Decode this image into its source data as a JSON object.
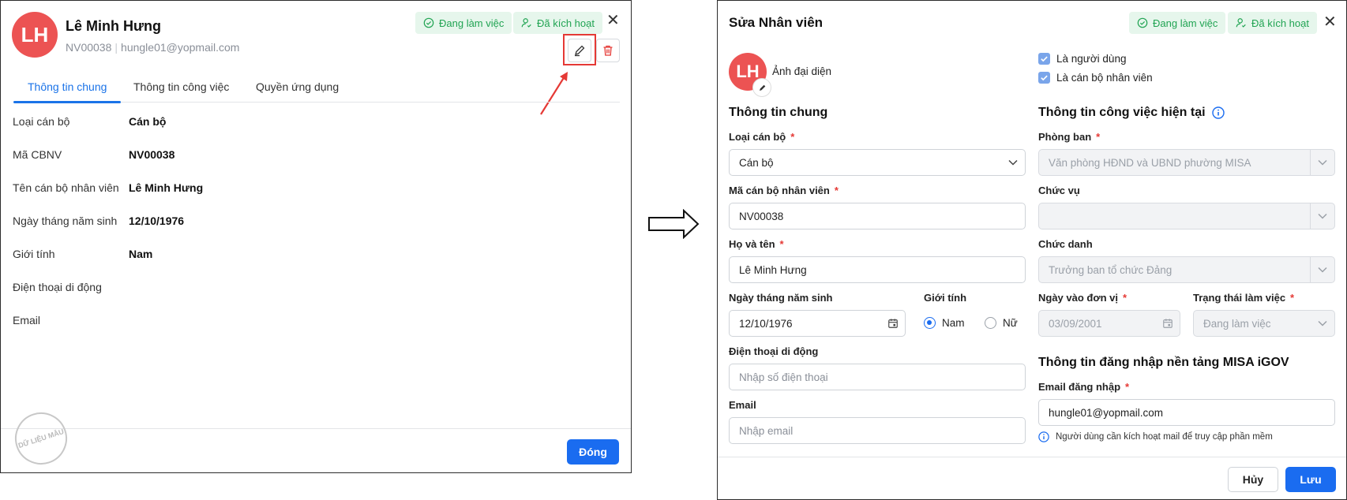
{
  "view": {
    "avatar_initials": "LH",
    "name": "Lê Minh Hưng",
    "code": "NV00038",
    "email": "hungle01@yopmail.com",
    "badges": {
      "working": "Đang làm việc",
      "activated": "Đã kích hoạt"
    },
    "tabs": [
      "Thông tin chung",
      "Thông tin công việc",
      "Quyền ứng dụng"
    ],
    "rows": [
      {
        "label": "Loại cán bộ",
        "value": "Cán bộ"
      },
      {
        "label": "Mã CBNV",
        "value": "NV00038"
      },
      {
        "label": "Tên cán bộ nhân viên",
        "value": "Lê Minh Hưng"
      },
      {
        "label": "Ngày tháng năm sinh",
        "value": "12/10/1976"
      },
      {
        "label": "Giới tính",
        "value": "Nam"
      },
      {
        "label": "Điện thoại di động",
        "value": ""
      },
      {
        "label": "Email",
        "value": ""
      }
    ],
    "close_label": "Đóng",
    "stamp_text": "DỮ LIỆU MẪU"
  },
  "edit": {
    "title": "Sửa Nhân viên",
    "badges": {
      "working": "Đang làm việc",
      "activated": "Đã kích hoạt"
    },
    "avatar_initials": "LH",
    "avatar_label": "Ảnh đại diện",
    "checks": {
      "is_user": "Là người dùng",
      "is_staff": "Là cán bộ nhân viên"
    },
    "general": {
      "title": "Thông tin chung",
      "staff_type_label": "Loại cán bộ",
      "staff_type_value": "Cán bộ",
      "code_label": "Mã cán bộ nhân viên",
      "code_value": "NV00038",
      "fullname_label": "Họ và tên",
      "fullname_value": "Lê Minh Hưng",
      "dob_label": "Ngày tháng năm sinh",
      "dob_value": "12/10/1976",
      "gender_label": "Giới tính",
      "gender_male": "Nam",
      "gender_female": "Nữ",
      "phone_label": "Điện thoại di động",
      "phone_placeholder": "Nhập số điện thoại",
      "email_label": "Email",
      "email_placeholder": "Nhập email"
    },
    "job": {
      "title": "Thông tin công việc hiện tại",
      "dept_label": "Phòng ban",
      "dept_value": "Văn phòng HĐND và UBND phường MISA",
      "position_label": "Chức vụ",
      "position_value": "",
      "jobtitle_label": "Chức danh",
      "jobtitle_value": "Trưởng ban tổ chức Đảng",
      "join_label": "Ngày vào đơn vị",
      "join_value": "03/09/2001",
      "status_label": "Trạng thái làm việc",
      "status_value": "Đang làm việc"
    },
    "login": {
      "title": "Thông tin đăng nhập nền tảng MISA iGOV",
      "email_label": "Email đăng nhập",
      "email_value": "hungle01@yopmail.com",
      "note": "Người dùng cần kích hoạt mail để truy cập phần mềm"
    },
    "cancel_label": "Hủy",
    "save_label": "Lưu"
  },
  "colors": {
    "primary": "#1a6cf0",
    "avatar": "#ec5353",
    "badge_bg": "#e6f6ec",
    "badge_text": "#21a453",
    "highlight": "#e53935"
  }
}
